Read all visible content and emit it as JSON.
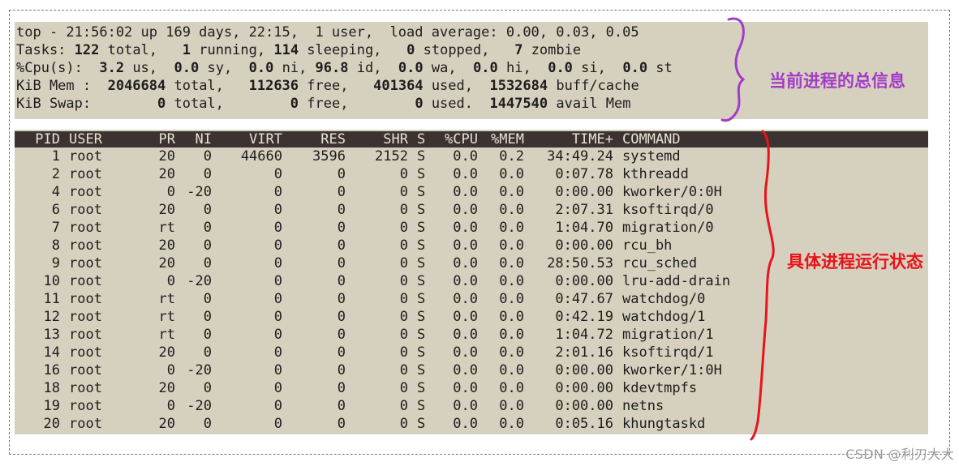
{
  "summary": {
    "line1": "top - 21:56:02 up 169 days, 22:15,  1 user,  load average: 0.00, 0.03, 0.05",
    "tasks": [
      "Tasks: ",
      "122",
      " total,   ",
      "1",
      " running, ",
      "114",
      " sleeping,   ",
      "0",
      " stopped,   ",
      "7",
      " zombie"
    ],
    "cpu": [
      "%Cpu(s):  ",
      "3.2",
      " us,  ",
      "0.0",
      " sy,  ",
      "0.0",
      " ni, ",
      "96.8",
      " id,  ",
      "0.0",
      " wa,  ",
      "0.0",
      " hi,  ",
      "0.0",
      " si,  ",
      "0.0",
      " st"
    ],
    "mem": [
      "KiB Mem :  ",
      "2046684",
      " total,   ",
      "112636",
      " free,   ",
      "401364",
      " used,  ",
      "1532684",
      " buff/cache"
    ],
    "swap": [
      "KiB Swap:        ",
      "0",
      " total,        ",
      "0",
      " free,        ",
      "0",
      " used.  ",
      "1447540",
      " avail Mem"
    ]
  },
  "table": {
    "headers": [
      "PID",
      "USER",
      "PR",
      "NI",
      "VIRT",
      "RES",
      "SHR",
      "S",
      "%CPU",
      "%MEM",
      "TIME+",
      "COMMAND"
    ],
    "rows": [
      [
        "1",
        "root",
        "20",
        "0",
        "44660",
        "3596",
        "2152",
        "S",
        "0.0",
        "0.2",
        "34:49.24",
        "systemd"
      ],
      [
        "2",
        "root",
        "20",
        "0",
        "0",
        "0",
        "0",
        "S",
        "0.0",
        "0.0",
        "0:07.78",
        "kthreadd"
      ],
      [
        "4",
        "root",
        "0",
        "-20",
        "0",
        "0",
        "0",
        "S",
        "0.0",
        "0.0",
        "0:00.00",
        "kworker/0:0H"
      ],
      [
        "6",
        "root",
        "20",
        "0",
        "0",
        "0",
        "0",
        "S",
        "0.0",
        "0.0",
        "2:07.31",
        "ksoftirqd/0"
      ],
      [
        "7",
        "root",
        "rt",
        "0",
        "0",
        "0",
        "0",
        "S",
        "0.0",
        "0.0",
        "1:04.70",
        "migration/0"
      ],
      [
        "8",
        "root",
        "20",
        "0",
        "0",
        "0",
        "0",
        "S",
        "0.0",
        "0.0",
        "0:00.00",
        "rcu_bh"
      ],
      [
        "9",
        "root",
        "20",
        "0",
        "0",
        "0",
        "0",
        "S",
        "0.0",
        "0.0",
        "28:50.53",
        "rcu_sched"
      ],
      [
        "10",
        "root",
        "0",
        "-20",
        "0",
        "0",
        "0",
        "S",
        "0.0",
        "0.0",
        "0:00.00",
        "lru-add-drain"
      ],
      [
        "11",
        "root",
        "rt",
        "0",
        "0",
        "0",
        "0",
        "S",
        "0.0",
        "0.0",
        "0:47.67",
        "watchdog/0"
      ],
      [
        "12",
        "root",
        "rt",
        "0",
        "0",
        "0",
        "0",
        "S",
        "0.0",
        "0.0",
        "0:42.19",
        "watchdog/1"
      ],
      [
        "13",
        "root",
        "rt",
        "0",
        "0",
        "0",
        "0",
        "S",
        "0.0",
        "0.0",
        "1:04.72",
        "migration/1"
      ],
      [
        "14",
        "root",
        "20",
        "0",
        "0",
        "0",
        "0",
        "S",
        "0.0",
        "0.0",
        "2:01.16",
        "ksoftirqd/1"
      ],
      [
        "16",
        "root",
        "0",
        "-20",
        "0",
        "0",
        "0",
        "S",
        "0.0",
        "0.0",
        "0:00.00",
        "kworker/1:0H"
      ],
      [
        "18",
        "root",
        "20",
        "0",
        "0",
        "0",
        "0",
        "S",
        "0.0",
        "0.0",
        "0:00.00",
        "kdevtmpfs"
      ],
      [
        "19",
        "root",
        "0",
        "-20",
        "0",
        "0",
        "0",
        "S",
        "0.0",
        "0.0",
        "0:00.00",
        "netns"
      ],
      [
        "20",
        "root",
        "20",
        "0",
        "0",
        "0",
        "0",
        "S",
        "0.0",
        "0.0",
        "0:05.16",
        "khungtaskd"
      ]
    ]
  },
  "annotations": {
    "summary_note": "当前进程的总信息",
    "process_note": "具体进程运行状态"
  },
  "watermark": "CSDN @利刃大大",
  "colors": {
    "terminal_bg": "#d6d0be",
    "header_bg": "#3c3231",
    "summary_note": "#a23cc8",
    "process_note": "#e8141c",
    "summary_bracket": "#a23cc8",
    "process_bracket": "#e8141c"
  }
}
